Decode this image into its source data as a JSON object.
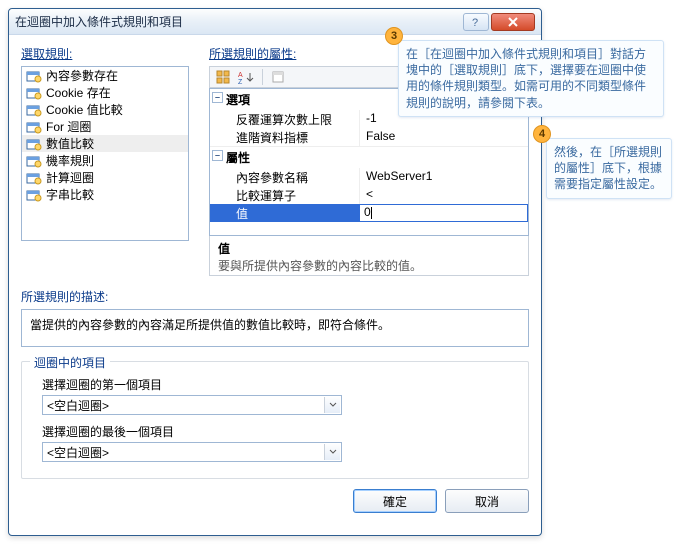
{
  "dialog": {
    "title": "在迴圈中加入條件式規則和項目"
  },
  "labels": {
    "select_rule": "選取規則:",
    "selected_props": "所選規則的屬性:",
    "rule_desc": "所選規則的描述:",
    "loop_items": "迴圈中的項目",
    "first_item": "選擇迴圈的第一個項目",
    "last_item": "選擇迴圈的最後一個項目"
  },
  "rules": [
    {
      "label": "內容參數存在"
    },
    {
      "label": "Cookie 存在"
    },
    {
      "label": "Cookie 值比較"
    },
    {
      "label": "For 迴圈"
    },
    {
      "label": "數值比較",
      "selected": true
    },
    {
      "label": "機率規則"
    },
    {
      "label": "計算迴圈"
    },
    {
      "label": "字串比較"
    }
  ],
  "props": {
    "sections": {
      "options": "選項",
      "attributes": "屬性"
    },
    "rows": {
      "repeat_limit": {
        "name": "反覆運算次數上限",
        "value": "-1"
      },
      "advanced": {
        "name": "進階資料指標",
        "value": "False"
      },
      "param_name": {
        "name": "內容參數名稱",
        "value": "WebServer1"
      },
      "operator": {
        "name": "比較運算子",
        "value": "<"
      },
      "value": {
        "name": "值",
        "value": "0"
      }
    },
    "desc": {
      "title": "值",
      "body": "要與所提供內容參數的內容比較的值。"
    }
  },
  "rule_desc_text": "當提供的內容參數的內容滿足所提供值的數值比較時，即符合條件。",
  "combo": {
    "first": "<空白迴圈>",
    "last": "<空白迴圈>"
  },
  "buttons": {
    "ok": "確定",
    "cancel": "取消"
  },
  "callouts": {
    "c3": {
      "num": "3",
      "text": "在［在迴圈中加入條件式規則和項目］對話方塊中的［選取規則］底下，選擇要在迴圈中使用的條件規則類型。如需可用的不同類型條件規則的說明，請參閱下表。"
    },
    "c4": {
      "num": "4",
      "text": "然後，在［所選規則的屬性］底下，根據需要指定屬性設定。"
    }
  }
}
